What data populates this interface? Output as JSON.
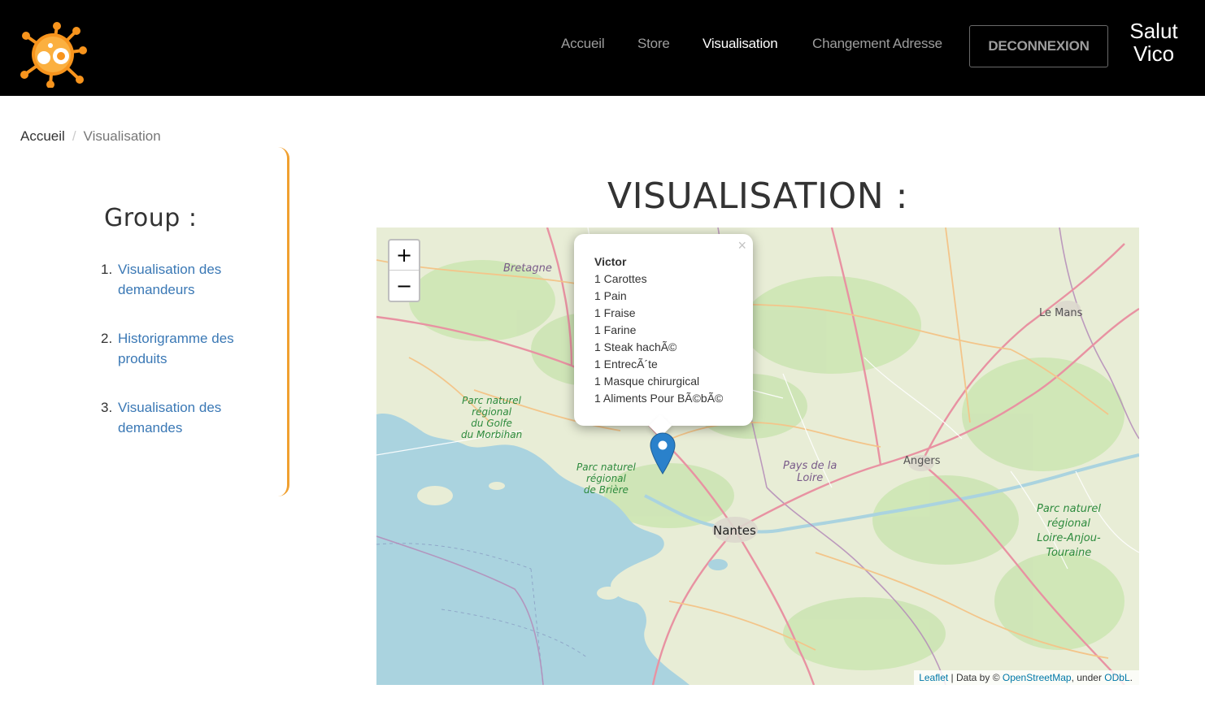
{
  "navbar": {
    "links": [
      {
        "label": "Accueil",
        "active": false
      },
      {
        "label": "Store",
        "active": false
      },
      {
        "label": "Visualisation",
        "active": true
      },
      {
        "label": "Changement Adresse",
        "active": false
      }
    ],
    "logout_label": "DECONNEXION",
    "greeting_line1": "Salut",
    "greeting_line2": "Vico",
    "logo_icon": "virus-logo-icon",
    "accent_color": "#f7941d"
  },
  "breadcrumb": {
    "home": "Accueil",
    "separator": "/",
    "current": "Visualisation"
  },
  "sidebar": {
    "title": "Group :",
    "items": [
      {
        "number": "1.",
        "label": "Visualisation des demandeurs"
      },
      {
        "number": "2.",
        "label": "Historigramme des produits"
      },
      {
        "number": "3.",
        "label": "Visualisation des demandes"
      }
    ],
    "border_color": "#f0a030"
  },
  "page": {
    "title": "VISUALISATION :"
  },
  "map": {
    "zoom_in": "+",
    "zoom_out": "−",
    "popup": {
      "close": "×",
      "name": "Victor",
      "items": [
        "1 Carottes",
        "1 Pain",
        "1 Fraise",
        "1 Farine",
        "1 Steak hachÃ©",
        "1 EntrecÃ´te",
        "1 Masque chirurgical",
        "1 Aliments Pour BÃ©bÃ©"
      ]
    },
    "labels": {
      "bretagne": "Bretagne",
      "le_mans": "Le Mans",
      "angers": "Angers",
      "nantes": "Nantes",
      "pays_loire_1": "Pays de la",
      "pays_loire_2": "Loire",
      "golfe_1": "Parc naturel",
      "golfe_2": "régional",
      "golfe_3": "du Golfe",
      "golfe_4": "du Morbihan",
      "briere_1": "Parc naturel",
      "briere_2": "régional",
      "briere_3": "de Brière",
      "anjou_1": "Parc naturel",
      "anjou_2": "régional",
      "anjou_3": "Loire-Anjou-",
      "anjou_4": "Touraine"
    },
    "attribution": {
      "leaflet": "Leaflet",
      "data_by": " | Data by © ",
      "osm": "OpenStreetMap",
      "under": ", under ",
      "odbl": "ODbL",
      "end": "."
    },
    "marker_color": "#2a81cb"
  }
}
